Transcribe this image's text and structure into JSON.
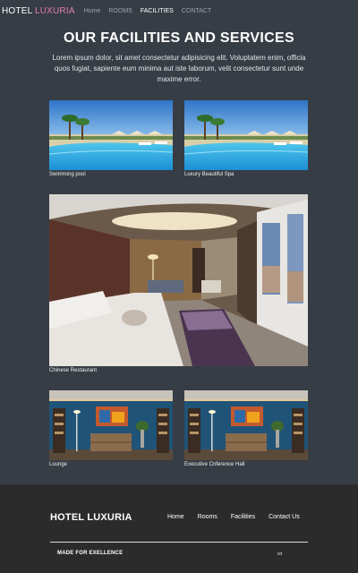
{
  "nav": {
    "brand_part1": "HOTEL ",
    "brand_part2": "LUXURIA",
    "links": [
      "Home",
      "ROOMS",
      "FACILITIES",
      "CONTACT"
    ],
    "active": "FACILITIES"
  },
  "hero": {
    "title": "OUR FACILITIES AND SERVICES",
    "text": "Lorem ipsum dolor, sit amet consectetur adipisicing elit. Voluptatem enim, officia quos fugiat, sapiente eum minima aut iste laborum, velit consectetur sunt unde maxime error."
  },
  "facilities": [
    {
      "caption": "Swimming pool",
      "image": "pool-photo"
    },
    {
      "caption": "Luxury Beautiful Spa",
      "image": "pool-photo"
    },
    {
      "caption": "Chinese Restaurant",
      "image": "hotel-room-photo"
    },
    {
      "caption": "Lounge",
      "image": "lounge-photo"
    },
    {
      "caption": "Executive Cnference Hall",
      "image": "lounge-photo"
    }
  ],
  "footer": {
    "brand": "HOTEL LUXURIA",
    "links": [
      "Home",
      "Rooms",
      "Facilities",
      "Contact Us"
    ],
    "tagline": "MADE FOR EXELLENCE",
    "small": "txt"
  },
  "colors": {
    "page_bg": "#373d45",
    "footer_bg": "#2b2b2b",
    "brand_accent": "#e07fa7"
  }
}
